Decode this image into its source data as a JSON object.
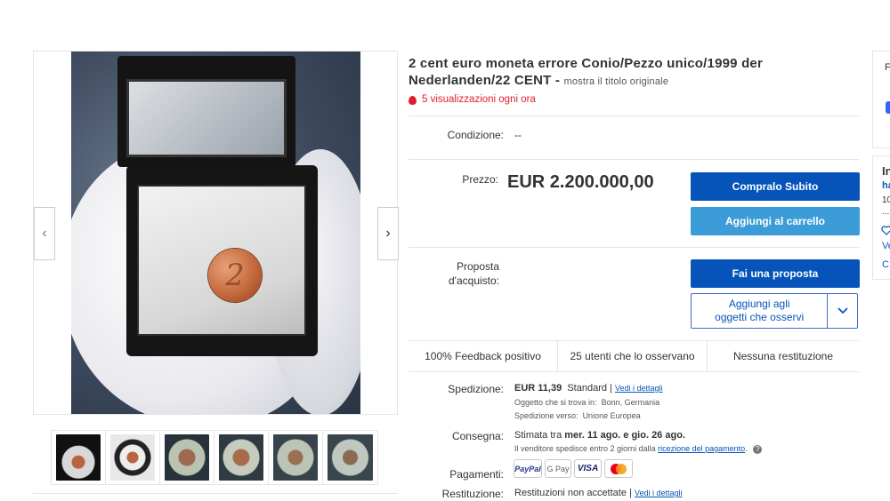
{
  "gallery": {
    "prev_icon": "chevron-left-icon",
    "next_icon": "chevron-right-icon",
    "prev_glyph": "‹",
    "next_glyph": "›",
    "coin_mark": "2",
    "thumbnail_count": 6
  },
  "listing": {
    "title": "2 cent euro moneta errore Conio/Pezzo unico/1999 der Nederlanden/22 CENT",
    "title_separator": " - ",
    "original_title_link": "mostra il titolo originale",
    "views": "5 visualizzazioni ogni ora",
    "views_icon": "flame-icon"
  },
  "condition": {
    "label": "Condizione:",
    "value": "--"
  },
  "price": {
    "label": "Prezzo:",
    "value": "EUR 2.200.000,00"
  },
  "buttons": {
    "buy_now": "Compralo Subito",
    "add_to_cart": "Aggiungi al carrello",
    "make_offer": "Fai una proposta",
    "watch_line1": "Aggiungi agli",
    "watch_line2": "oggetti che osservi",
    "watch_chevron": "chevron-down-icon"
  },
  "offer": {
    "label_line1": "Proposta",
    "label_line2": "d'acquisto:"
  },
  "stats": [
    "100% Feedback positivo",
    "25 utenti che lo osservano",
    "Nessuna restituzione"
  ],
  "shipping": {
    "label": "Spedizione:",
    "price": "EUR 11,39",
    "method": "Standard",
    "separator": "|",
    "details_link": "Vedi i dettagli",
    "location_label": "Oggetto che si trova in:",
    "location": "Bonn, Germania",
    "ships_to_label": "Spedizione verso:",
    "ships_to": "Unione Europea"
  },
  "delivery": {
    "label": "Consegna:",
    "prefix": "Stimata tra",
    "date_range": "mer. 11 ago. e gio. 26 ago.",
    "note_prefix": "Il venditore spedisce entro 2 giorni dalla",
    "note_link": "ricezione del pagamento",
    "note_suffix": ".",
    "help_glyph": "?"
  },
  "payments": {
    "label": "Pagamenti:",
    "methods": [
      "PayPal",
      "G Pay",
      "VISA",
      "Mastercard"
    ]
  },
  "returns": {
    "label": "Restituzione:",
    "value": "Restituzioni non accettate",
    "separator": "|",
    "details_link": "Vedi i dettagli"
  },
  "side_panels": {
    "top_letter": "F",
    "second_title": "In",
    "second_link": "ha",
    "second_count": "10",
    "second_dots": "...",
    "second_v": "Ve",
    "second_c": "C"
  },
  "colors": {
    "primary_button": "#0654ba",
    "secondary_button": "#3c9cd7",
    "views_red": "#dd1e31"
  }
}
